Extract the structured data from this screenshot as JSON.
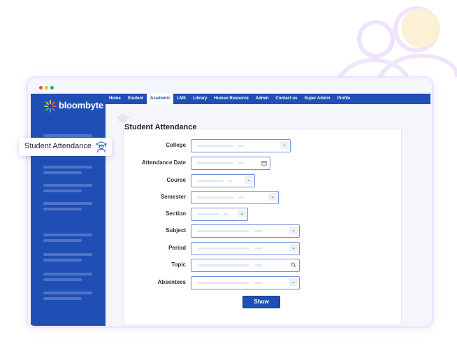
{
  "app": {
    "logo_text": "bloombyte"
  },
  "nav": {
    "items": [
      {
        "label": "Home"
      },
      {
        "label": "Student"
      },
      {
        "label": "Academic",
        "active": true
      },
      {
        "label": "LMS"
      },
      {
        "label": "Library"
      },
      {
        "label": "Human Resource"
      },
      {
        "label": "Admin"
      },
      {
        "label": "Contact us"
      },
      {
        "label": "Super Admin"
      },
      {
        "label": "Profile"
      }
    ]
  },
  "chip": {
    "label": "Student Attendance",
    "icon": "graduate-icon"
  },
  "page": {
    "title": "Student Attendance"
  },
  "form": {
    "college": {
      "label": "College",
      "icon": "chevron-down-icon"
    },
    "attendance_date": {
      "label": "Attendance Date",
      "icon": "calendar-icon"
    },
    "course": {
      "label": "Course",
      "icon": "chevron-down-icon"
    },
    "semester": {
      "label": "Semester",
      "icon": "chevron-down-icon"
    },
    "section": {
      "label": "Section",
      "icon": "chevron-down-icon"
    },
    "subject": {
      "label": "Subject",
      "icon": "chevron-down-icon"
    },
    "period": {
      "label": "Period",
      "icon": "chevron-down-icon"
    },
    "topic": {
      "label": "Topic",
      "icon": "search-icon"
    },
    "absentees": {
      "label": "Absentees",
      "icon": "chevron-down-icon"
    },
    "show_label": "Show"
  },
  "colors": {
    "primary": "#1f4fb5",
    "field_border": "#6f8ee0"
  }
}
